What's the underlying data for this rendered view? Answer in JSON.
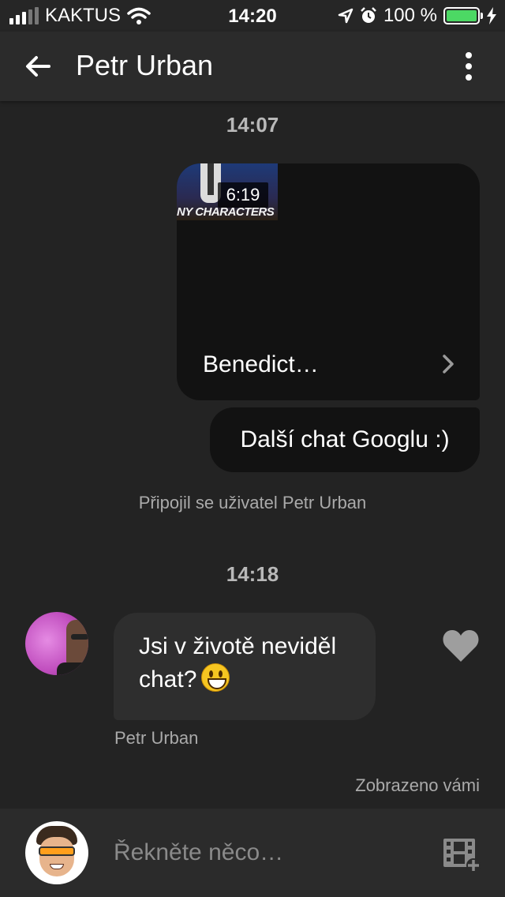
{
  "status_bar": {
    "carrier": "KAKTUS",
    "time": "14:20",
    "battery": "100 %",
    "signal_bars_filled": 3,
    "signal_bars_total": 5
  },
  "header": {
    "title": "Petr Urban",
    "back_icon": "arrow-left-icon",
    "menu_icon": "more-vertical-icon"
  },
  "messages": {
    "time_1": "14:07",
    "video": {
      "thumbnail_caption": "NY CHARACTERS",
      "duration": "6:19",
      "title": "Benedict…"
    },
    "outgoing_text": "Další chat Googlu :)",
    "system_notice": "Připojil se uživatel Petr Urban",
    "time_2": "14:18",
    "incoming_text": "Jsi v životě neviděl chat?",
    "incoming_emoji": "grinning-face-emoji",
    "sender_name": "Petr Urban",
    "seen_label": "Zobrazeno vámi"
  },
  "composer": {
    "placeholder": "Řekněte něco…",
    "value": "",
    "media_icon": "add-video-icon"
  },
  "colors": {
    "background": "#232323",
    "bar": "#2b2b2b",
    "bubble_out": "#121212",
    "bubble_in": "#2e2e2e",
    "battery_fill": "#4cd964",
    "muted_text": "#aaaaaa"
  }
}
